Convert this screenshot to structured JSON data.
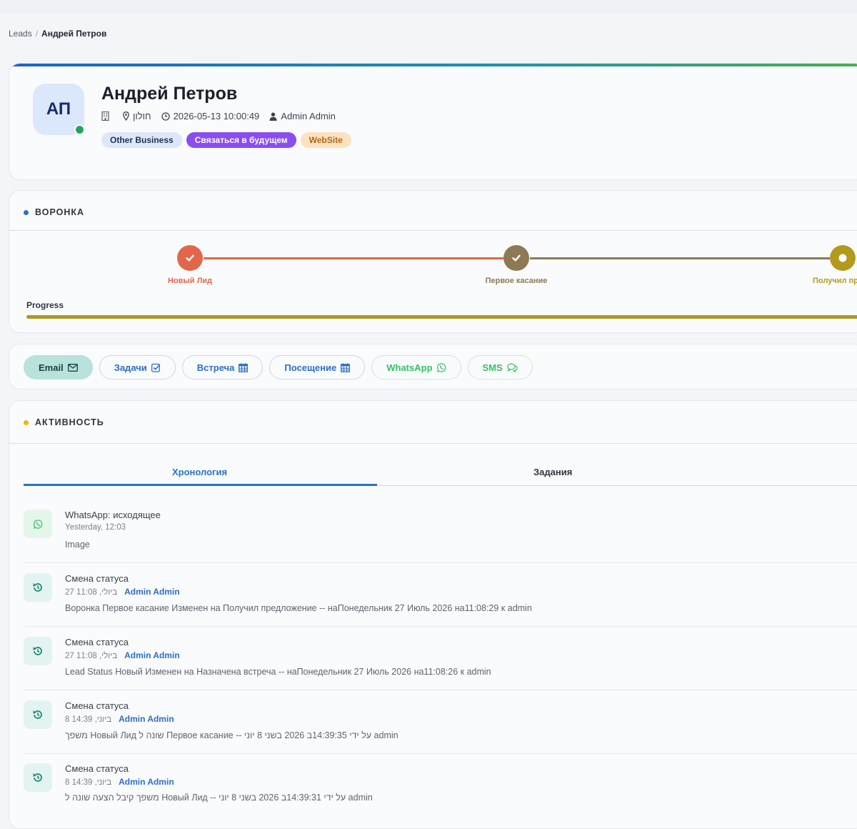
{
  "breadcrumb": {
    "root": "Leads",
    "separator": "/",
    "current": "Андрей Петров"
  },
  "lead": {
    "initials": "АП",
    "name": "Андрей Петров",
    "location": "חולון",
    "datetime": "2026-05-13 10:00:49",
    "owner": "Admin Admin",
    "tags": [
      "Other Business",
      "Связаться в будущем",
      "WebSite"
    ]
  },
  "funnel": {
    "title": "ВОРОНКА",
    "steps": [
      {
        "label": "Новый Лид",
        "color": "#e2674a",
        "state": "done"
      },
      {
        "label": "Первое касание",
        "color": "#8d7a55",
        "state": "done"
      },
      {
        "label": "Получил предл",
        "color": "#b39a1d",
        "state": "current"
      }
    ],
    "progress_label": "Progress",
    "progress": 1.0
  },
  "actions": [
    {
      "label": "Email",
      "icon": "envelope-icon"
    },
    {
      "label": "Задачи",
      "icon": "check-square-icon"
    },
    {
      "label": "Встреча",
      "icon": "calendar-icon"
    },
    {
      "label": "Посещение",
      "icon": "calendar-icon"
    },
    {
      "label": "WhatsApp",
      "icon": "whatsapp-icon"
    },
    {
      "label": "SMS",
      "icon": "chat-icon"
    }
  ],
  "activity": {
    "title": "АКТИВНОСТЬ",
    "tabs": [
      "Хронология",
      "Задания"
    ],
    "items": [
      {
        "icon": "whatsapp-icon",
        "title": "WhatsApp: исходящее",
        "time": "Yesterday, 12:03",
        "author": "",
        "body": "Image"
      },
      {
        "icon": "history-icon",
        "title": "Смена статуса",
        "time": "27 11:08 ,ביולי",
        "author": "Admin Admin",
        "body": "Воронка Первое касание Изменен на Получил предложение -- наПонедельник 27 Июль 2026 на11:08:29 к admin"
      },
      {
        "icon": "history-icon",
        "title": "Смена статуса",
        "time": "27 11:08 ,ביולי",
        "author": "Admin Admin",
        "body": "Lead Status Новый Изменен на Назначена встреча -- наПонедельник 27 Июль 2026 на11:08:26 к admin"
      },
      {
        "icon": "history-icon",
        "title": "Смена статуса",
        "time": "8 14:39 ,ביוני",
        "author": "Admin Admin",
        "body": "משפך Новый Лид שונה ל Первое касание -- על ידי 14:39:35ב 2026 בשני 8 יוני admin"
      },
      {
        "icon": "history-icon",
        "title": "Смена статуса",
        "time": "8 14:39 ,ביוני",
        "author": "Admin Admin",
        "body": "משפך קיבל הצעה שונה ל Новый Лид -- על ידי 14:39:31ב 2026 בשני 8 יוני admin"
      }
    ]
  },
  "colors": {
    "accent_blue": "#2872c8",
    "whatsapp_green": "#35c266",
    "online": "#22a55a",
    "tag_purple": "#8a4df0",
    "progress": "#ac9822"
  }
}
